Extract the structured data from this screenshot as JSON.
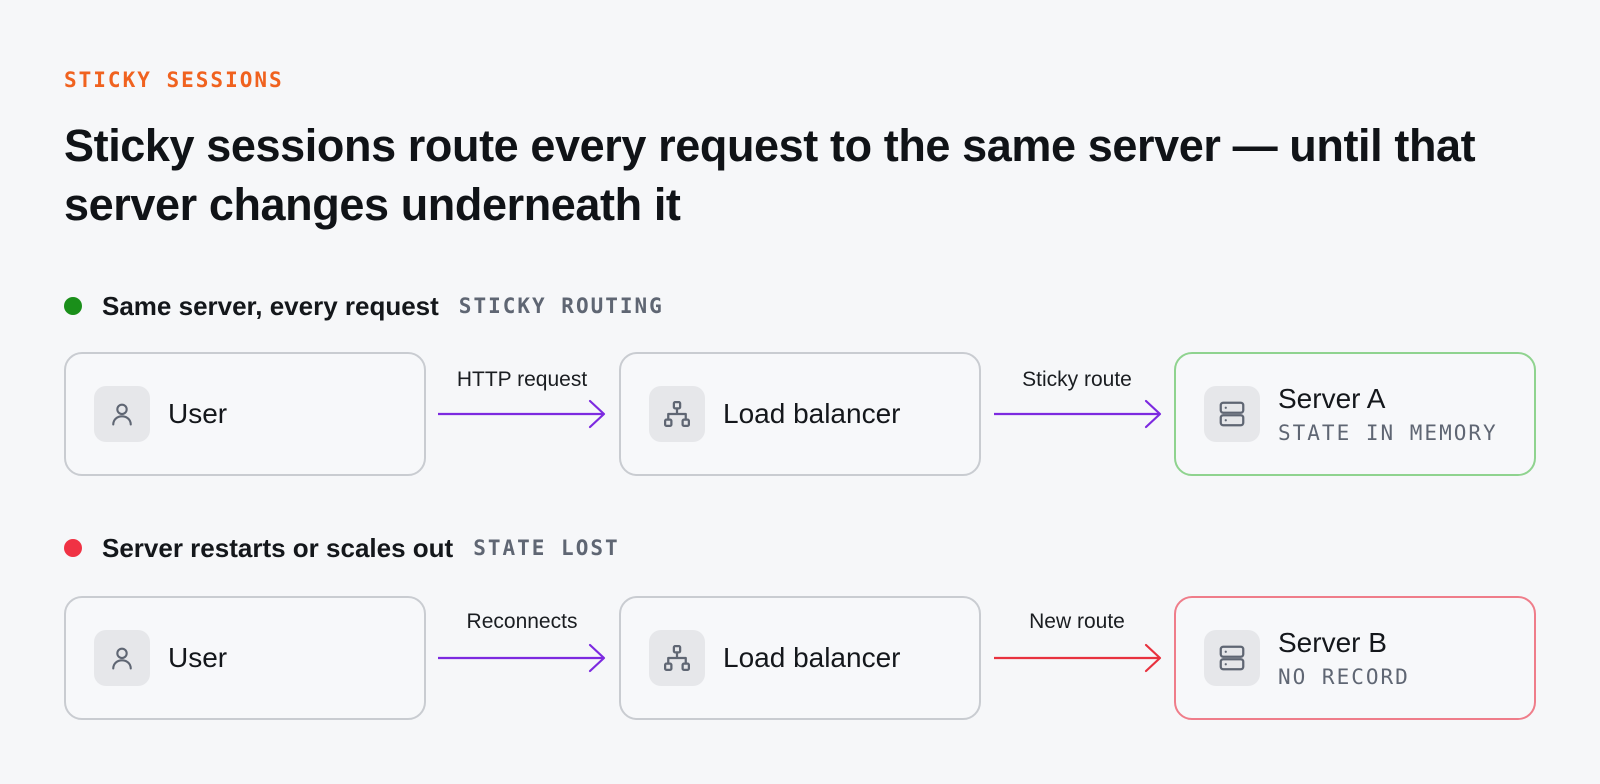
{
  "eyebrow": "STICKY SESSIONS",
  "headline": "Sticky sessions route every request to the same server — until that server changes underneath it",
  "colors": {
    "accent": "#f0621f",
    "arrow_purple": "#7d2ae0",
    "arrow_red": "#e8323f",
    "status_green": "#1a8f1a",
    "status_red": "#f03244",
    "border_ok": "#8fd38f",
    "border_bad": "#ef7d8a"
  },
  "rows": [
    {
      "status": "ok",
      "title": "Same server, every request",
      "tag": "STICKY ROUTING",
      "user": {
        "label": "User",
        "icon": "user-icon"
      },
      "arrow1_label": "HTTP request",
      "balancer": {
        "label": "Load balancer",
        "icon": "network-icon"
      },
      "arrow2_label": "Sticky route",
      "server": {
        "label": "Server A",
        "sub": "STATE IN MEMORY",
        "icon": "server-icon"
      }
    },
    {
      "status": "bad",
      "title": "Server restarts or scales out",
      "tag": "STATE LOST",
      "user": {
        "label": "User",
        "icon": "user-icon"
      },
      "arrow1_label": "Reconnects",
      "balancer": {
        "label": "Load balancer",
        "icon": "network-icon"
      },
      "arrow2_label": "New route",
      "server": {
        "label": "Server B",
        "sub": "NO RECORD",
        "icon": "server-icon"
      }
    }
  ]
}
